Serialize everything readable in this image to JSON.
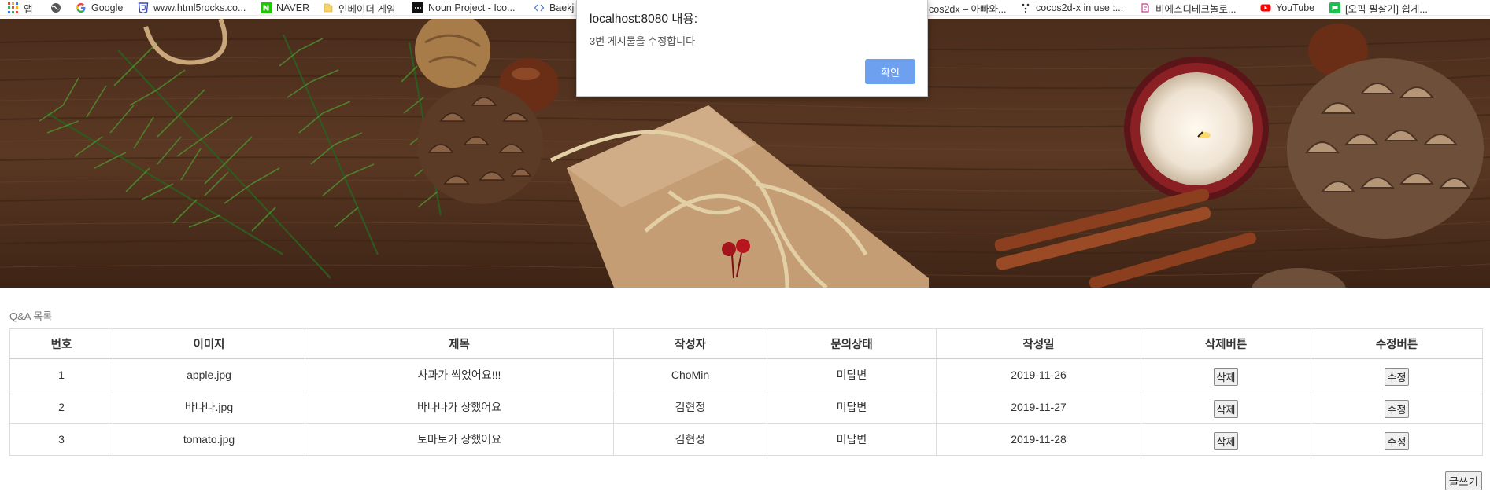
{
  "bookmarks": [
    {
      "label": "앱",
      "icon": "apps-grid-icon"
    },
    {
      "label": "",
      "icon": "globe-icon"
    },
    {
      "label": "Google",
      "icon": "google-icon"
    },
    {
      "label": "www.html5rocks.co...",
      "icon": "html5-icon"
    },
    {
      "label": "NAVER",
      "icon": "naver-icon"
    },
    {
      "label": "인베이더 게임",
      "icon": "folder-icon"
    },
    {
      "label": "Noun Project - Ico...",
      "icon": "noun-project-icon"
    },
    {
      "label": "Baekj",
      "icon": "code-icon"
    },
    {
      "label": "cos2dx – 아빠와...",
      "icon": ""
    },
    {
      "label": "cocos2d-x in use :...",
      "icon": "cocos-icon"
    },
    {
      "label": "비에스디테크놀로...",
      "icon": "bsd-icon"
    },
    {
      "label": "YouTube",
      "icon": "youtube-icon"
    },
    {
      "label": "[오픽 필살기] 쉽게...",
      "icon": "opic-icon"
    }
  ],
  "dialog": {
    "title": "localhost:8080 내용:",
    "message": "3번 게시물을 수정합니다",
    "ok_label": "확인",
    "ok_color": "#6ea0f0"
  },
  "section_title": "Q&A 목록",
  "table": {
    "headers": [
      "번호",
      "이미지",
      "제목",
      "작성자",
      "문의상태",
      "작성일",
      "삭제버튼",
      "수정버튼"
    ],
    "rows": [
      {
        "no": "1",
        "image": "apple.jpg",
        "title": "사과가 썩었어요!!!",
        "author": "ChoMin",
        "status": "미답변",
        "date": "2019-11-26",
        "delete": "삭제",
        "edit": "수정"
      },
      {
        "no": "2",
        "image": "바나나.jpg",
        "title": "바나나가 상했어요",
        "author": "김현정",
        "status": "미답변",
        "date": "2019-11-27",
        "delete": "삭제",
        "edit": "수정"
      },
      {
        "no": "3",
        "image": "tomato.jpg",
        "title": "토마토가 상했어요",
        "author": "김현정",
        "status": "미답변",
        "date": "2019-11-28",
        "delete": "삭제",
        "edit": "수정"
      }
    ]
  },
  "write_button": "글쓰기"
}
